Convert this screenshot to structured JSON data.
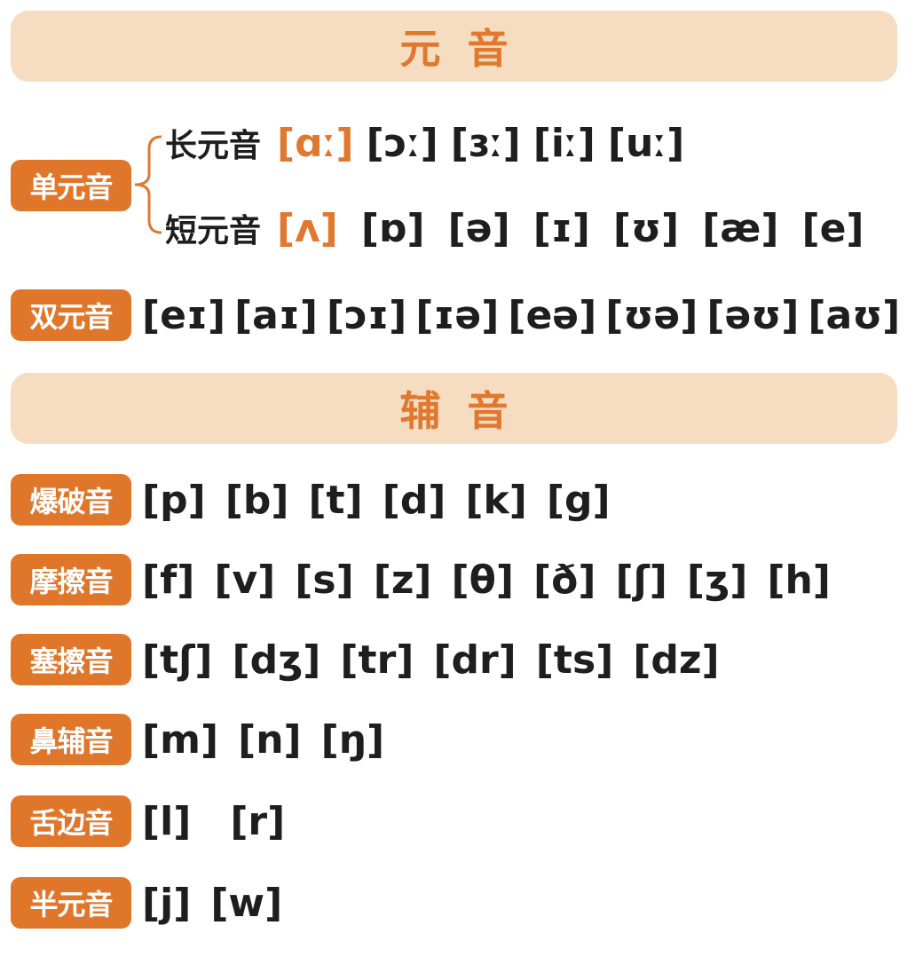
{
  "vowels": {
    "title": "元音",
    "monophthongs": {
      "label": "单元音",
      "long": {
        "label": "长元音",
        "symbols": [
          {
            "text": "[ɑː]",
            "highlight": true
          },
          {
            "text": "[ɔː]",
            "highlight": false
          },
          {
            "text": "[ɜː]",
            "highlight": false
          },
          {
            "text": "[iː]",
            "highlight": false
          },
          {
            "text": "[uː]",
            "highlight": false
          }
        ]
      },
      "short": {
        "label": "短元音",
        "symbols": [
          {
            "text": "[ʌ]",
            "highlight": true
          },
          {
            "text": "[ɒ]",
            "highlight": false
          },
          {
            "text": "[ə]",
            "highlight": false
          },
          {
            "text": "[ɪ]",
            "highlight": false
          },
          {
            "text": "[ʊ]",
            "highlight": false
          },
          {
            "text": "[æ]",
            "highlight": false
          },
          {
            "text": "[e]",
            "highlight": false
          }
        ]
      }
    },
    "diphthongs": {
      "label": "双元音",
      "symbols": [
        "[eɪ]",
        "[aɪ]",
        "[ɔɪ]",
        "[ɪə]",
        "[eə]",
        "[ʊə]",
        "[əʊ]",
        "[aʊ]"
      ]
    }
  },
  "consonants": {
    "title": "辅音",
    "groups": [
      {
        "label": "爆破音",
        "symbols": [
          "[p]",
          "[b]",
          "[t]",
          "[d]",
          "[k]",
          "[g]"
        ]
      },
      {
        "label": "摩擦音",
        "symbols": [
          "[f]",
          "[v]",
          "[s]",
          "[z]",
          "[θ]",
          "[ð]",
          "[ʃ]",
          "[ʒ]",
          "[h]"
        ]
      },
      {
        "label": "塞擦音",
        "symbols": [
          "[tʃ]",
          "[dʒ]",
          "[tr]",
          "[dr]",
          "[ts]",
          "[dz]"
        ]
      },
      {
        "label": "鼻辅音",
        "symbols": [
          "[m]",
          "[n]",
          "[ŋ]"
        ]
      },
      {
        "label": "舌边音",
        "symbols": [
          "[l]",
          "[r]"
        ]
      },
      {
        "label": "半元音",
        "symbols": [
          "[j]",
          "[w]"
        ]
      }
    ]
  },
  "colors": {
    "accent": "#e0782f",
    "banner": "#f6dcc0",
    "badge": "#e0762a",
    "text": "#1e1e1e"
  }
}
